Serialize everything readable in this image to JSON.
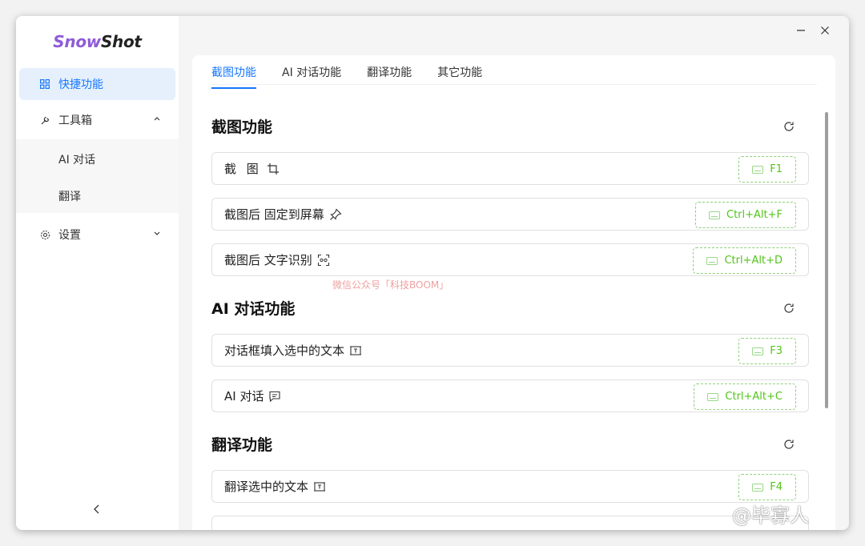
{
  "app": {
    "logo_part1": "Snow",
    "logo_part2": "Shot"
  },
  "sidebar": {
    "items": [
      {
        "label": "快捷功能",
        "icon": "grid-icon",
        "active": true
      },
      {
        "label": "工具箱",
        "icon": "wrench-icon",
        "expanded": true
      },
      {
        "label": "设置",
        "icon": "gear-icon",
        "expanded": false
      }
    ],
    "toolbox_children": [
      "AI 对话",
      "翻译"
    ],
    "collapse_glyph": "<"
  },
  "window": {
    "minimize": "−",
    "close": "✕"
  },
  "tabs": [
    "截图功能",
    "AI 对话功能",
    "翻译功能",
    "其它功能"
  ],
  "sections": [
    {
      "title": "截图功能",
      "rows": [
        {
          "label": "截 图",
          "icon": "crop-icon",
          "shortcut": "F1"
        },
        {
          "label": "截图后 固定到屏幕",
          "icon": "pin-icon",
          "shortcut": "Ctrl+Alt+F"
        },
        {
          "label": "截图后 文字识别",
          "icon": "ocr-scan-icon",
          "shortcut": "Ctrl+Alt+D"
        }
      ]
    },
    {
      "title": "AI 对话功能",
      "rows": [
        {
          "label": "对话框填入选中的文本",
          "icon": "text-select-icon",
          "shortcut": "F3"
        },
        {
          "label": "AI 对话",
          "icon": "chat-icon",
          "shortcut": "Ctrl+Alt+C"
        }
      ]
    },
    {
      "title": "翻译功能",
      "rows": [
        {
          "label": "翻译选中的文本",
          "icon": "text-select-icon",
          "shortcut": "F4"
        }
      ]
    }
  ],
  "overlay": {
    "watermark": "微信公众号「科技BOOM」",
    "brand": "@毕寡人"
  },
  "colors": {
    "accent": "#1677ff",
    "shortcut": "#52c41a",
    "logo": "#8e5bd8"
  }
}
